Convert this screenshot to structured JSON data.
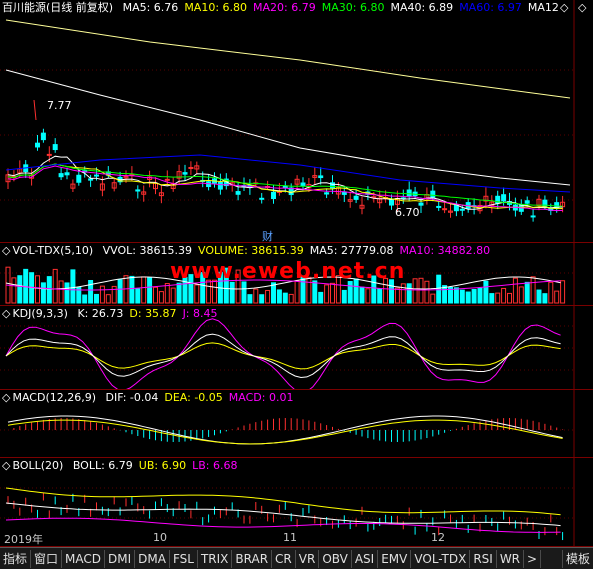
{
  "main": {
    "title": "百川能源(日线 前复权)",
    "ma_labels": [
      {
        "text": "MA5: 6.76",
        "color": "#ffffff"
      },
      {
        "text": "MA10: 6.80",
        "color": "#ffff00"
      },
      {
        "text": "MA20: 6.79",
        "color": "#ff00ff"
      },
      {
        "text": "MA30: 6.80",
        "color": "#00ff00"
      },
      {
        "text": "MA40: 6.89",
        "color": "#ffffff"
      },
      {
        "text": "MA60: 6.97",
        "color": "#0000ff"
      },
      {
        "text": "MA12",
        "color": "#ffffff"
      }
    ],
    "high_marker": "7.77",
    "low_marker": "6.70",
    "finance_marker": "财",
    "controls": {
      "collapse": "◇",
      "close": "◇"
    }
  },
  "volume": {
    "title": "VOL-TDX(5,10)",
    "labels": [
      {
        "text": "VVOL: 38615.39",
        "color": "#ffffff"
      },
      {
        "text": "VOLUME: 38615.39",
        "color": "#ffff00"
      },
      {
        "text": "MA5: 27779.08",
        "color": "#ffffff"
      },
      {
        "text": "MA10: 34882.80",
        "color": "#ff00ff"
      }
    ]
  },
  "watermark": "www.eweb.net.cn",
  "kdj": {
    "title": "KDJ(9,3,3)",
    "labels": [
      {
        "text": "K: 26.73",
        "color": "#ffffff"
      },
      {
        "text": "D: 35.87",
        "color": "#ffff00"
      },
      {
        "text": "J: 8.45",
        "color": "#ff00ff"
      }
    ]
  },
  "macd": {
    "title": "MACD(12,26,9)",
    "labels": [
      {
        "text": "DIF: -0.04",
        "color": "#ffffff"
      },
      {
        "text": "DEA: -0.05",
        "color": "#ffff00"
      },
      {
        "text": "MACD: 0.01",
        "color": "#ff00ff"
      }
    ]
  },
  "boll": {
    "title": "BOLL(20)",
    "labels": [
      {
        "text": "BOLL: 6.79",
        "color": "#ffffff"
      },
      {
        "text": "UB: 6.90",
        "color": "#ffff00"
      },
      {
        "text": "LB: 6.68",
        "color": "#ff00ff"
      }
    ]
  },
  "dates": [
    "2019年",
    "10",
    "11",
    "12"
  ],
  "tabs": [
    "指标",
    "窗口",
    "MACD",
    "DMI",
    "DMA",
    "FSL",
    "TRIX",
    "BRAR",
    "CR",
    "VR",
    "OBV",
    "ASI",
    "EMV",
    "VOL-TDX",
    "RSI",
    "WR",
    ">"
  ],
  "tab_right": "模板"
}
